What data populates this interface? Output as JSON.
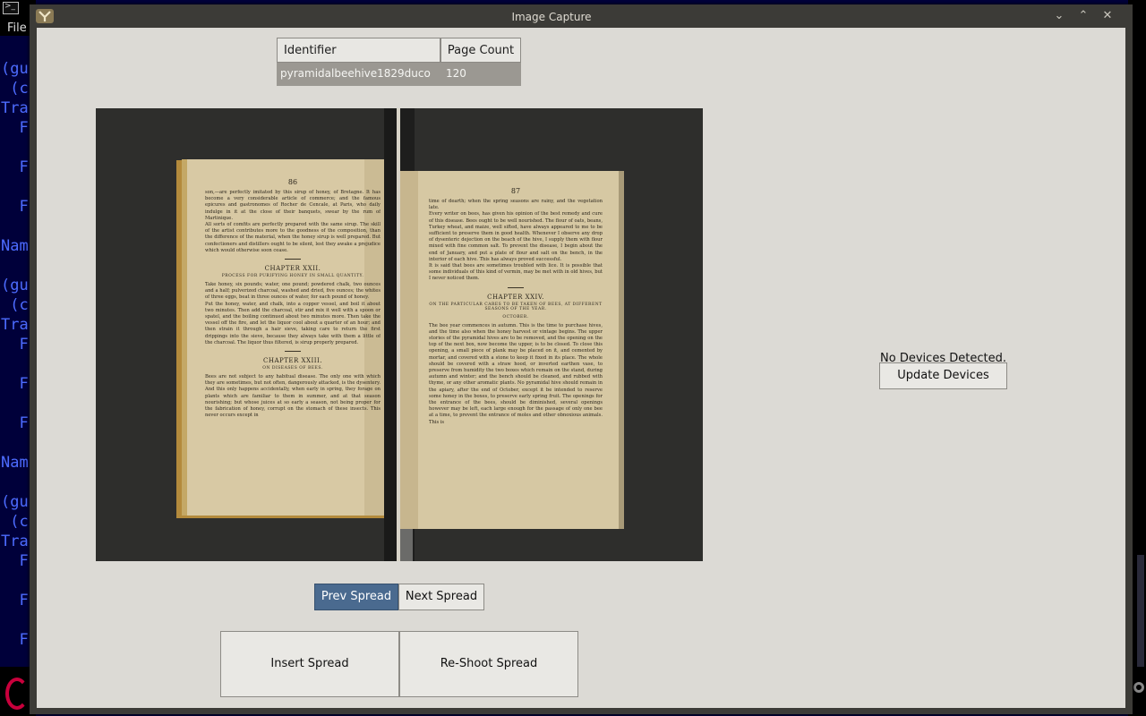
{
  "background_terminal": {
    "menu_label": "File",
    "lines": [
      "(gu",
      " (c",
      "Tra",
      "  F",
      "  F",
      "  F",
      "Nam",
      "(gu",
      " (c",
      "Tra",
      "  F",
      "  F",
      "  F",
      "Nam",
      "(gu",
      " (c",
      "Tra",
      "  F",
      "  F",
      "  F"
    ]
  },
  "window": {
    "title": "Image Capture"
  },
  "table": {
    "headers": [
      "Identifier",
      "Page Count"
    ],
    "rows": [
      {
        "identifier": "pyramidalbeehive1829duco",
        "page_count": "120"
      }
    ]
  },
  "spread": {
    "left_page": {
      "number": "86",
      "para1": "son,—are perfectly imitated by this sirup of honey, of Bretagne. It has become a very considerable article of commerce; and the famous epicures and gastronomes of Rocher de Cencale, at Paris, who daily indulge in it at the close of their banquets, swear by the rum of Martinique.",
      "para2": "All sorts of comfits are perfectly prepared with the same sirup. The skill of the artist contributes more to the goodness of the composition, than the difference of the material, when the honey sirup is well prepared. But confectioners and distillers ought to be silent, lest they awake a prejudice which would otherwise soon cease.",
      "chapter1": "CHAPTER XXII.",
      "sub1": "PROCESS FOR PURIFYING HONEY IN SMALL QUANTITY.",
      "para3": "Take honey, six pounds; water, one pound; powdered chalk, two ounces and a half; pulverized charcoal, washed and dried, five ounces; the whites of three eggs, beat in three ounces of water, for each pound of honey.",
      "para4": "Put the honey, water, and chalk, into a copper vessel, and boil it about two minutes. Then add the charcoal, stir and mix it well with a spoon or spatel, and the boiling continued about two minutes more. Then take the vessel off the fire, and let the liquor cool about a quarter of an hour; and then strain it through a hair sieve, taking care to return the first drippings into the sieve, because they always take with them a little of the charcoal. The liquor thus filtered, is sirup properly prepared.",
      "chapter2": "CHAPTER XXIII.",
      "sub2": "ON DISEASES OF BEES.",
      "para5": "Bees are not subject to any habitual disease. The only one with which they are sometimes, but not often, dangerously attacked, is the dysentery. And this only happens accidentally, when early in spring, they forage on plants which are familiar to them in summer, and at that season nourishing; but whose juices at so early a season, not being proper for the fabrication of honey, corrupt on the stomach of these insects. This never occurs except in"
    },
    "right_page": {
      "number": "87",
      "para1": "time of dearth; when the spring seasons are rainy, and the vegetation late.",
      "para2": "Every writer on bees, has given his opinion of the best remedy and cure of this disease. Bees ought to be well nourished. The flour of oats, beans, Turkey wheat, and maize, well sifted, have always appeared to me to be sufficient to preserve them in good health. Whenever I observe any drop of dysenteric dejection on the beach of the hive, I supply them with flour mixed with fine common salt. To prevent the disease, I begin about the end of January, and put a plate of flour and salt on the bench, in the interior of each hive. This has always proved successful.",
      "para3": "It is said that bees are sometimes troubled with lice. It is possible that some individuals of this kind of vermin, may be met with in old hives, but I never noticed them.",
      "chapter": "CHAPTER XXIV.",
      "sub": "ON THE PARTICULAR CARES TO BE TAKEN OF BEES, AT DIFFERENT SEASONS OF THE YEAR.",
      "season": "OCTOBER.",
      "para4": "The bee year commences in autumn. This is the time to purchase hives, and the time also when the honey harvest or vintage begins. The upper stories of the pyramidal hives are to be removed, and the opening on the top of the next box, now become the upper, is to be closed. To close this opening, a small piece of plank may be placed on it, and cemented by mortar, and covered with a stone to keep it fixed in its place. The whole should be covered with a straw hood, or inverted earthen vase, to preserve from humidity the two boxes which remain on the stand, during autumn and winter; and the bench should be cleaned, and rubbed with thyme, or any other aromatic plants. No pyramidal hive should remain in the apiary, after the end of October, except it be intended to reserve some honey in the boxes, to preserve early spring fruit. The openings for the entrance of the bees, should be diminished, several openings however may be left, each large enough for the passage of only one bee at a time, to prevent the entrance of moles and other obnoxious animals. This is"
    }
  },
  "buttons": {
    "prev": "Prev Spread",
    "next": "Next Spread",
    "insert": "Insert Spread",
    "reshoot": "Re-Shoot Spread",
    "update_devices": "Update Devices"
  },
  "status": {
    "devices": "No Devices Detected."
  },
  "colors": {
    "window_bg": "#dcdad5",
    "titlebar_bg": "#3c3b37",
    "selected_button": "#4a6a8f",
    "table_row": "#9b9892"
  }
}
